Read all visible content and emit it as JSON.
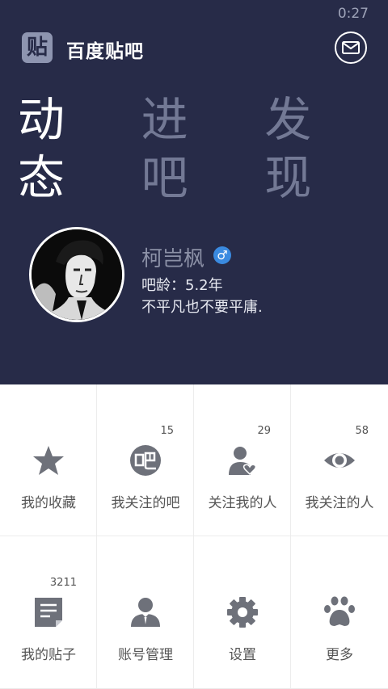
{
  "status_bar": {
    "time": "0:27"
  },
  "app": {
    "logo_glyph": "贴",
    "name": "百度贴吧"
  },
  "tabs": [
    {
      "label": "动态",
      "active": true
    },
    {
      "label": "进吧",
      "active": false
    },
    {
      "label": "发现",
      "active": false
    }
  ],
  "profile": {
    "username": "柯岂枫",
    "gender_symbol": "♂",
    "age_label": "吧龄：5.2年",
    "signature": "不平凡也不要平庸."
  },
  "grid": [
    {
      "label": "我的收藏",
      "count": "",
      "icon": "star-icon"
    },
    {
      "label": "我关注的吧",
      "count": "15",
      "icon": "ba-icon"
    },
    {
      "label": "关注我的人",
      "count": "29",
      "icon": "follower-icon"
    },
    {
      "label": "我关注的人",
      "count": "58",
      "icon": "eye-icon"
    },
    {
      "label": "我的贴子",
      "count": "3211",
      "icon": "document-icon"
    },
    {
      "label": "账号管理",
      "count": "",
      "icon": "account-icon"
    },
    {
      "label": "设置",
      "count": "",
      "icon": "gear-icon"
    },
    {
      "label": "更多",
      "count": "",
      "icon": "paw-icon"
    }
  ],
  "colors": {
    "header_bg": "#272b48",
    "icon_gray": "#6e717a",
    "badge_blue": "#3a8ae0"
  }
}
